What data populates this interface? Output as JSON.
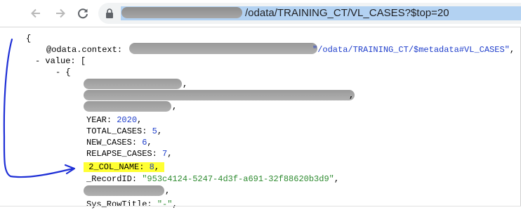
{
  "browser": {
    "url_path": "/odata/TRAINING_CT/VL_CASES?$top=20",
    "icons": {
      "back": "back-arrow-icon",
      "forward": "forward-arrow-icon",
      "reload": "reload-icon",
      "lock": "lock-icon"
    }
  },
  "json": {
    "open_brace": "{",
    "context_key": "@odata.context: ",
    "context_value_suffix": "/odata/TRAINING_CT/$metadata#VL_CASES",
    "value_toggle": "- ",
    "value_key": "value: [",
    "item_toggle": "- {",
    "fields": [
      {
        "key": "YEAR",
        "value": "2020"
      },
      {
        "key": "TOTAL_CASES",
        "value": "5"
      },
      {
        "key": "NEW_CASES",
        "value": "6"
      },
      {
        "key": "RELAPSE_CASES",
        "value": "7"
      },
      {
        "key": "2_COL_NAME",
        "value": "8"
      }
    ],
    "record_id_key": "_RecordID",
    "record_id_value": "\"953c4124-5247-4d3f-a691-32f88620b3d9\"",
    "sys_row_title_key": "Sys_RowTitle",
    "sys_row_title_value": "\"-\""
  },
  "colors": {
    "highlight": "#ffff33",
    "string": "#2e8b30",
    "number": "#1f3ecb",
    "annotation": "#1e2fd6"
  }
}
